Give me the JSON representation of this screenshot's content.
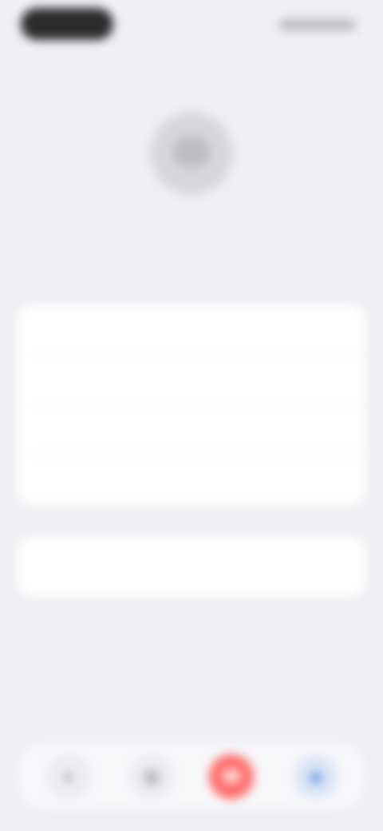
{
  "profile": {
    "name": "",
    "subtitle": ""
  },
  "menu": {
    "items": [
      {
        "label": "",
        "icon": "none"
      },
      {
        "label": "",
        "icon": "none"
      },
      {
        "label": "",
        "icon": "none"
      },
      {
        "label": "",
        "icon": "none"
      }
    ]
  },
  "sign_out": {
    "label": "",
    "color": "#ff6b62"
  },
  "dock": {
    "items": [
      {
        "label": "",
        "icon": "person-icon"
      },
      {
        "label": "",
        "icon": "grid-icon"
      },
      {
        "label": "",
        "icon": "phone-icon",
        "color": "#ff6b6b"
      },
      {
        "label": "",
        "icon": "chat-icon",
        "color": "#5b8fe0"
      }
    ]
  }
}
